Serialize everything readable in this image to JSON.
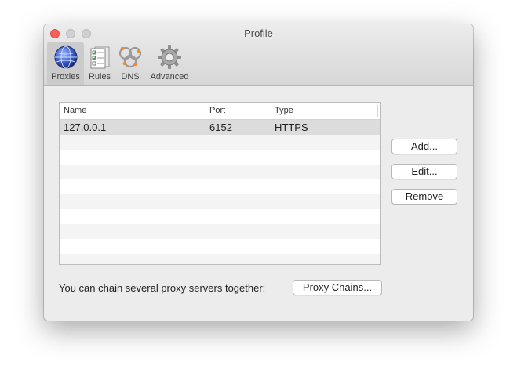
{
  "window": {
    "title": "Profile"
  },
  "toolbar": {
    "tabs": [
      {
        "label": "Proxies",
        "icon": "globe-icon",
        "selected": true
      },
      {
        "label": "Rules",
        "icon": "checklist-icon",
        "selected": false
      },
      {
        "label": "DNS",
        "icon": "dns-icon",
        "selected": false
      },
      {
        "label": "Advanced",
        "icon": "gear-icon",
        "selected": false
      }
    ]
  },
  "proxy_table": {
    "columns": [
      "Name",
      "Port",
      "Type"
    ],
    "rows": [
      {
        "name": "127.0.0.1",
        "port": "6152",
        "type": "HTTPS"
      }
    ]
  },
  "buttons": {
    "add": "Add...",
    "edit": "Edit...",
    "remove": "Remove",
    "proxy_chains": "Proxy Chains..."
  },
  "chain_text": "You can chain several proxy servers together:",
  "colors": {
    "close": "#fc5f57",
    "window_bg": "#ececec",
    "selected_tab": "#cbcbcb",
    "selected_row": "#dcdcdc"
  }
}
